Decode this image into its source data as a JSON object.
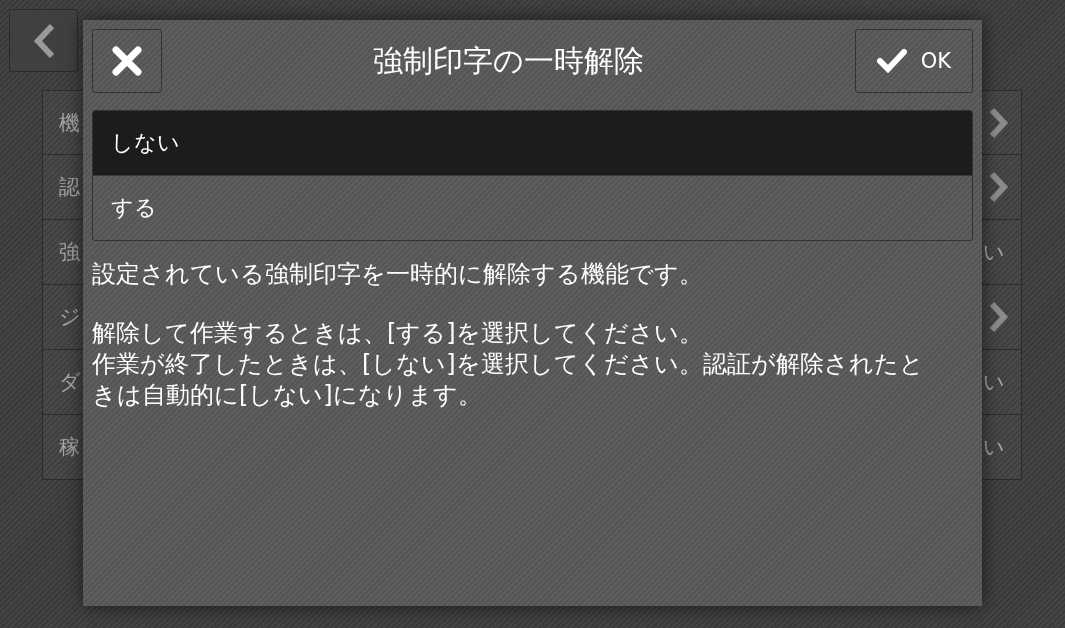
{
  "back_button": {
    "kind": "back"
  },
  "settings_list": [
    {
      "label": "機",
      "kind": "submenu"
    },
    {
      "label": "認",
      "kind": "submenu"
    },
    {
      "label": "強",
      "kind": "value",
      "value": "い"
    },
    {
      "label": "ジ",
      "kind": "submenu"
    },
    {
      "label": "ダ",
      "kind": "value",
      "value": "い"
    },
    {
      "label": "稼",
      "kind": "value",
      "value": "い"
    }
  ],
  "dialog": {
    "title": "強制印字の一時解除",
    "ok_button": "OK",
    "options": [
      {
        "label": "しない",
        "selected": true
      },
      {
        "label": "する",
        "selected": false
      }
    ],
    "description": [
      [
        "設定されている強制印字を一時的に解除する機能です。"
      ],
      [
        "解除して作業するときは、[する]を選択してください。",
        "作業が終了したときは、[しない]を選択してください。認証が解除されたときは自動的に[しない]になります。"
      ]
    ]
  }
}
